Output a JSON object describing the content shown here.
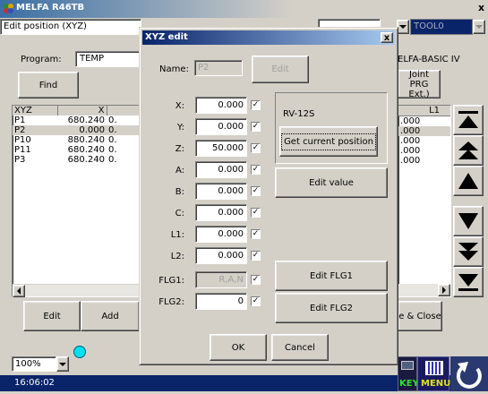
{
  "window": {
    "title": "MELFA R46TB",
    "close_glyph": "x"
  },
  "top_combo": {
    "value": "Edit position (XYZ)"
  },
  "tool_combo": {
    "value": "TOOL0"
  },
  "program": {
    "label": "Program:",
    "value": "TEMP"
  },
  "find_button": "Find",
  "lang_label": "ELFA-BASIC IV",
  "joint_button": {
    "line1": "Joint",
    "line2": "PRG Ext.)"
  },
  "table": {
    "headers": [
      "XYZ",
      "X",
      ""
    ],
    "rows": [
      {
        "name": "P1",
        "x": "680.240",
        "y": "0."
      },
      {
        "name": "P2",
        "x": "0.000",
        "y": "0."
      },
      {
        "name": "P10",
        "x": "880.240",
        "y": "0."
      },
      {
        "name": "P11",
        "x": "680.240",
        "y": "0."
      },
      {
        "name": "P3",
        "x": "680.240",
        "y": "0."
      }
    ],
    "selected_index": 1
  },
  "right_table": {
    "header": "L1",
    "values": [
      ".000",
      ".000",
      ".000",
      ".000",
      ".000"
    ],
    "header_right": ""
  },
  "bottom_buttons": {
    "edit": "Edit",
    "add": "Add",
    "save_close": "e & Close"
  },
  "zoom": {
    "value": "100%"
  },
  "status": {
    "time": "16:06:02",
    "key_label": "KEY",
    "menu_label": "MENU"
  },
  "dialog": {
    "title": "XYZ edit",
    "close_glyph": "x",
    "name_label": "Name:",
    "name_value": "P2",
    "name_edit_button": "Edit",
    "fields": [
      {
        "label": "X:",
        "value": "0.000",
        "checked": true
      },
      {
        "label": "Y:",
        "value": "0.000",
        "checked": true
      },
      {
        "label": "Z:",
        "value": "50.000",
        "checked": true
      },
      {
        "label": "A:",
        "value": "0.000",
        "checked": true
      },
      {
        "label": "B:",
        "value": "0.000",
        "checked": true
      },
      {
        "label": "C:",
        "value": "0.000",
        "checked": true
      },
      {
        "label": "L1:",
        "value": "0.000",
        "checked": true
      },
      {
        "label": "L2:",
        "value": "0.000",
        "checked": true
      }
    ],
    "flg1": {
      "label": "FLG1:",
      "value": "R,A,N",
      "checked": true
    },
    "flg2": {
      "label": "FLG2:",
      "value": "0",
      "checked": true
    },
    "robot_model": "RV-12S",
    "get_current_button": "Get current position",
    "edit_value_button": "Edit value",
    "edit_flg1_button": "Edit FLG1",
    "edit_flg2_button": "Edit FLG2",
    "ok_button": "OK",
    "cancel_button": "Cancel",
    "check_glyph": "✓"
  }
}
